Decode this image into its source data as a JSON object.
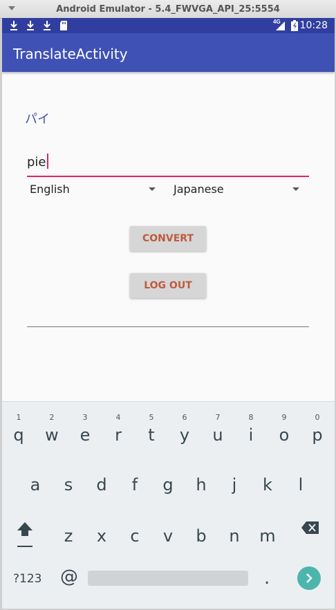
{
  "window": {
    "title": "Android Emulator - 5.4_FWVGA_API_25:5554"
  },
  "statusbar": {
    "time": "10:28",
    "network": "4G",
    "icons": [
      "download-icon",
      "download-icon",
      "download-icon",
      "sdcard-icon",
      "signal-icon",
      "battery-icon"
    ]
  },
  "appbar": {
    "title": "TranslateActivity"
  },
  "main": {
    "translated_text": "パイ",
    "input_value": "pie",
    "source_language": "English",
    "target_language": "Japanese",
    "convert_label": "CONVERT",
    "logout_label": "LOG OUT"
  },
  "keyboard": {
    "row1": [
      {
        "ch": "q",
        "num": "1"
      },
      {
        "ch": "w",
        "num": "2"
      },
      {
        "ch": "e",
        "num": "3"
      },
      {
        "ch": "r",
        "num": "4"
      },
      {
        "ch": "t",
        "num": "5"
      },
      {
        "ch": "y",
        "num": "6"
      },
      {
        "ch": "u",
        "num": "7"
      },
      {
        "ch": "i",
        "num": "8"
      },
      {
        "ch": "o",
        "num": "9"
      },
      {
        "ch": "p",
        "num": "0"
      }
    ],
    "row2": [
      "a",
      "s",
      "d",
      "f",
      "g",
      "h",
      "j",
      "k",
      "l"
    ],
    "row3": [
      "z",
      "x",
      "c",
      "v",
      "b",
      "n",
      "m"
    ],
    "symbols_label": "?123",
    "at_label": "@",
    "period_label": "."
  },
  "colors": {
    "primary": "#3f51b5",
    "primary_dark": "#303f9f",
    "accent": "#e91e63",
    "button_text": "#bf5a3e",
    "go_key": "#4db6ac"
  }
}
